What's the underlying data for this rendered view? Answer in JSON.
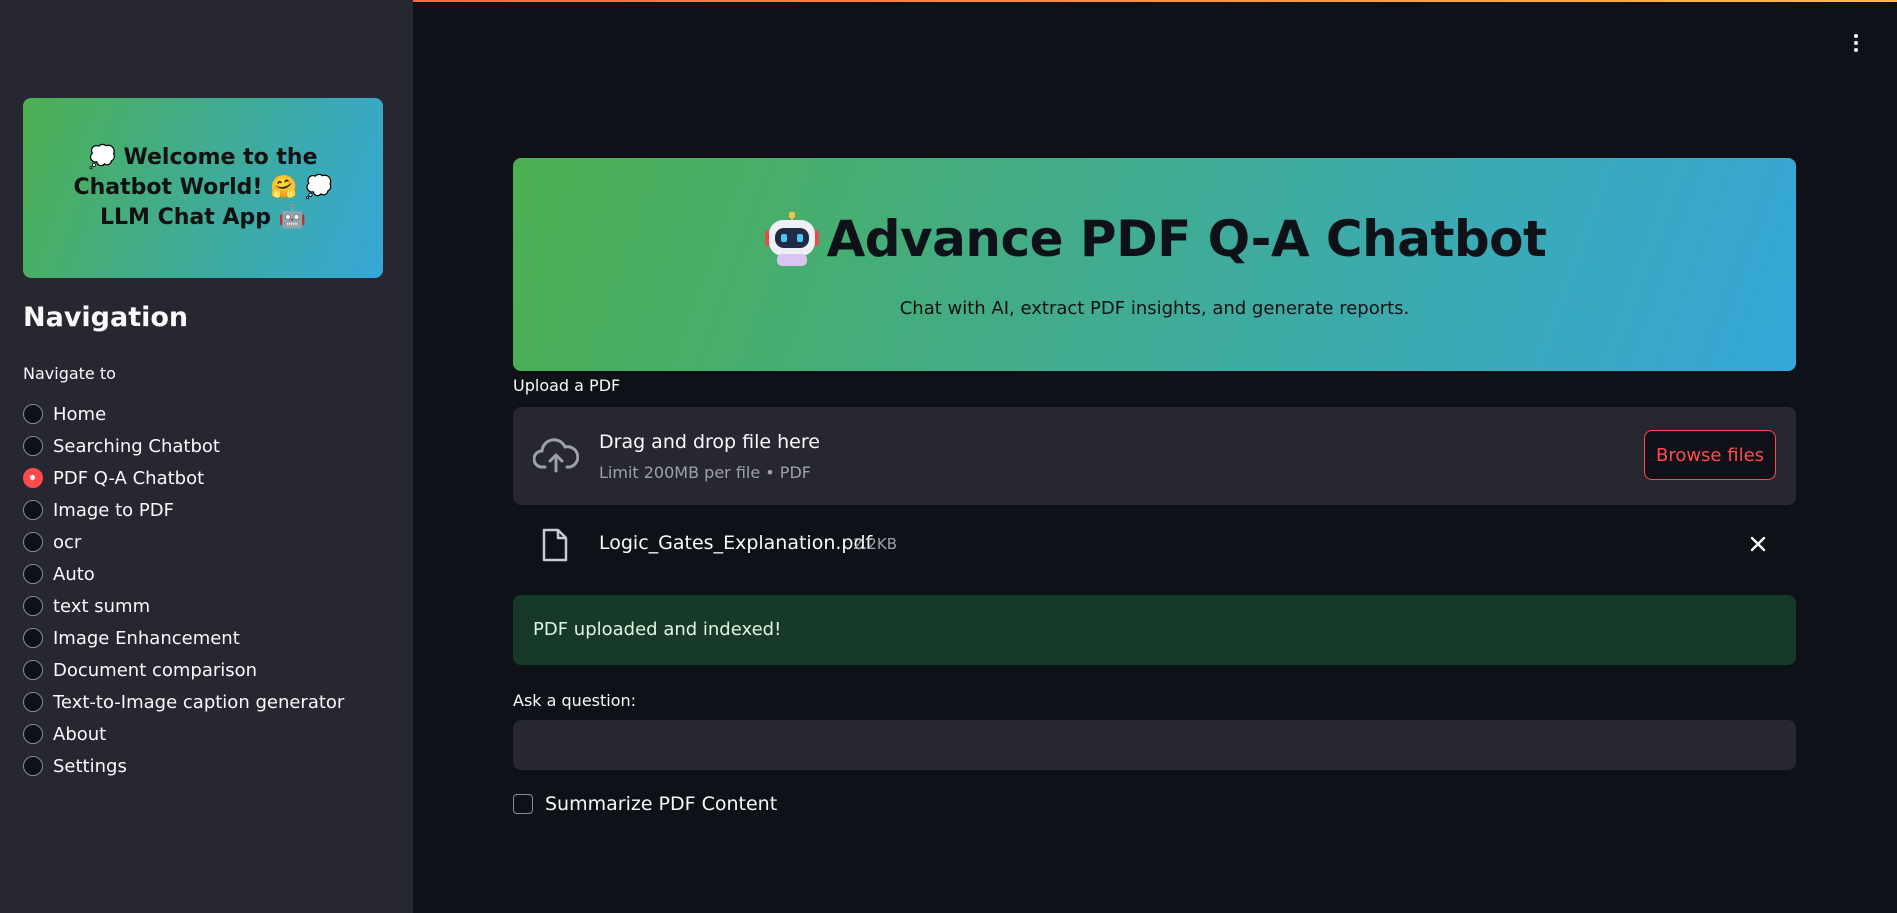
{
  "sidebar": {
    "welcome_text": "💭 Welcome to the Chatbot World! 🤗 💭 LLM Chat App 🤖",
    "nav_title": "Navigation",
    "nav_subtitle": "Navigate to",
    "items": [
      {
        "label": "Home",
        "selected": false
      },
      {
        "label": "Searching Chatbot",
        "selected": false
      },
      {
        "label": "PDF Q-A Chatbot",
        "selected": true
      },
      {
        "label": "Image to PDF",
        "selected": false
      },
      {
        "label": "ocr",
        "selected": false
      },
      {
        "label": "Auto",
        "selected": false
      },
      {
        "label": "text summ",
        "selected": false
      },
      {
        "label": "Image Enhancement",
        "selected": false
      },
      {
        "label": "Document comparison",
        "selected": false
      },
      {
        "label": "Text-to-Image caption generator",
        "selected": false
      },
      {
        "label": "About",
        "selected": false
      },
      {
        "label": "Settings",
        "selected": false
      }
    ]
  },
  "hero": {
    "title": "Advance PDF Q-A Chatbot",
    "subtitle": "Chat with AI, extract PDF insights, and generate reports."
  },
  "upload": {
    "label": "Upload a PDF",
    "drop_title": "Drag and drop file here",
    "limit_text": "Limit 200MB per file • PDF",
    "browse_label": "Browse files"
  },
  "file": {
    "name": "Logic_Gates_Explanation.pdf",
    "size": "2.2KB"
  },
  "status": {
    "message": "PDF uploaded and indexed!"
  },
  "question": {
    "label": "Ask a question:",
    "value": ""
  },
  "summarize": {
    "label": "Summarize PDF Content",
    "checked": false
  },
  "colors": {
    "accent": "#ff4b4b",
    "sidebar_bg": "#262730",
    "main_bg": "#0e1117",
    "gradient_start": "#4caf50",
    "gradient_end": "#34a8d9",
    "success_bg": "#173928"
  }
}
